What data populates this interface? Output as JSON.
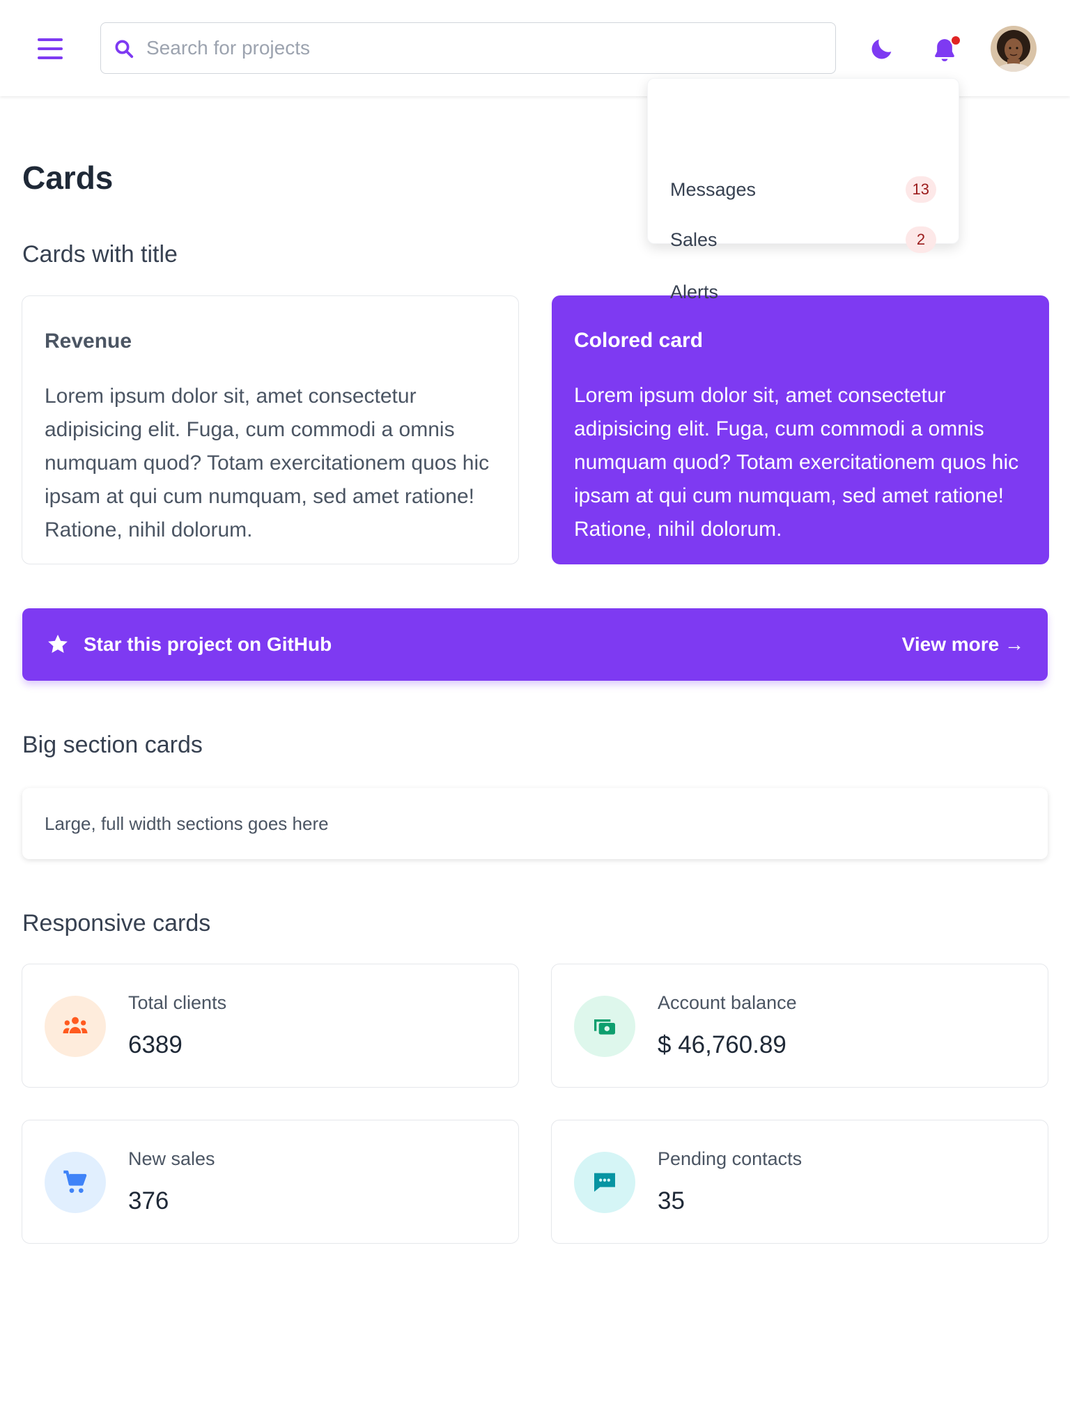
{
  "header": {
    "search_placeholder": "Search for projects",
    "notifications_dot": true
  },
  "dropdown": {
    "items": [
      {
        "label": "Messages",
        "badge": "13"
      },
      {
        "label": "Sales",
        "badge": "2"
      },
      {
        "label": "Alerts",
        "badge": ""
      }
    ]
  },
  "page": {
    "title": "Cards",
    "section_cards_with_title": "Cards with title",
    "section_big": "Big section cards",
    "section_responsive": "Responsive cards"
  },
  "title_cards": [
    {
      "title": "Revenue",
      "body": "Lorem ipsum dolor sit, amet consectetur adipisicing elit. Fuga, cum commodi a omnis numquam quod? Totam exercitationem quos hic ipsam at qui cum numquam, sed amet ratione! Ratione, nihil dolorum."
    },
    {
      "title": "Colored card",
      "body": "Lorem ipsum dolor sit, amet consectetur adipisicing elit. Fuga, cum commodi a omnis numquam quod? Totam exercitationem quos hic ipsam at qui cum numquam, sed amet ratione! Ratione, nihil dolorum."
    }
  ],
  "banner": {
    "text": "Star this project on GitHub",
    "link": "View more →"
  },
  "big_card": {
    "text": "Large, full width sections goes here"
  },
  "responsive_cards": [
    {
      "label": "Total clients",
      "value": "6389",
      "icon": "users-icon",
      "color": "#ff5a1f",
      "bg": "#feecdc"
    },
    {
      "label": "Account balance",
      "value": "$ 46,760.89",
      "icon": "cash-icon",
      "color": "#0e9f6e",
      "bg": "#def7ec"
    },
    {
      "label": "New sales",
      "value": "376",
      "icon": "cart-icon",
      "color": "#3f83f8",
      "bg": "#e1effe"
    },
    {
      "label": "Pending contacts",
      "value": "35",
      "icon": "chat-icon",
      "color": "#0694a2",
      "bg": "#d5f5f6"
    }
  ],
  "colors": {
    "accent": "#7e3af2",
    "badge_bg": "#fde8e8",
    "badge_text": "#9b1c1c",
    "notification_dot": "#e02424"
  }
}
